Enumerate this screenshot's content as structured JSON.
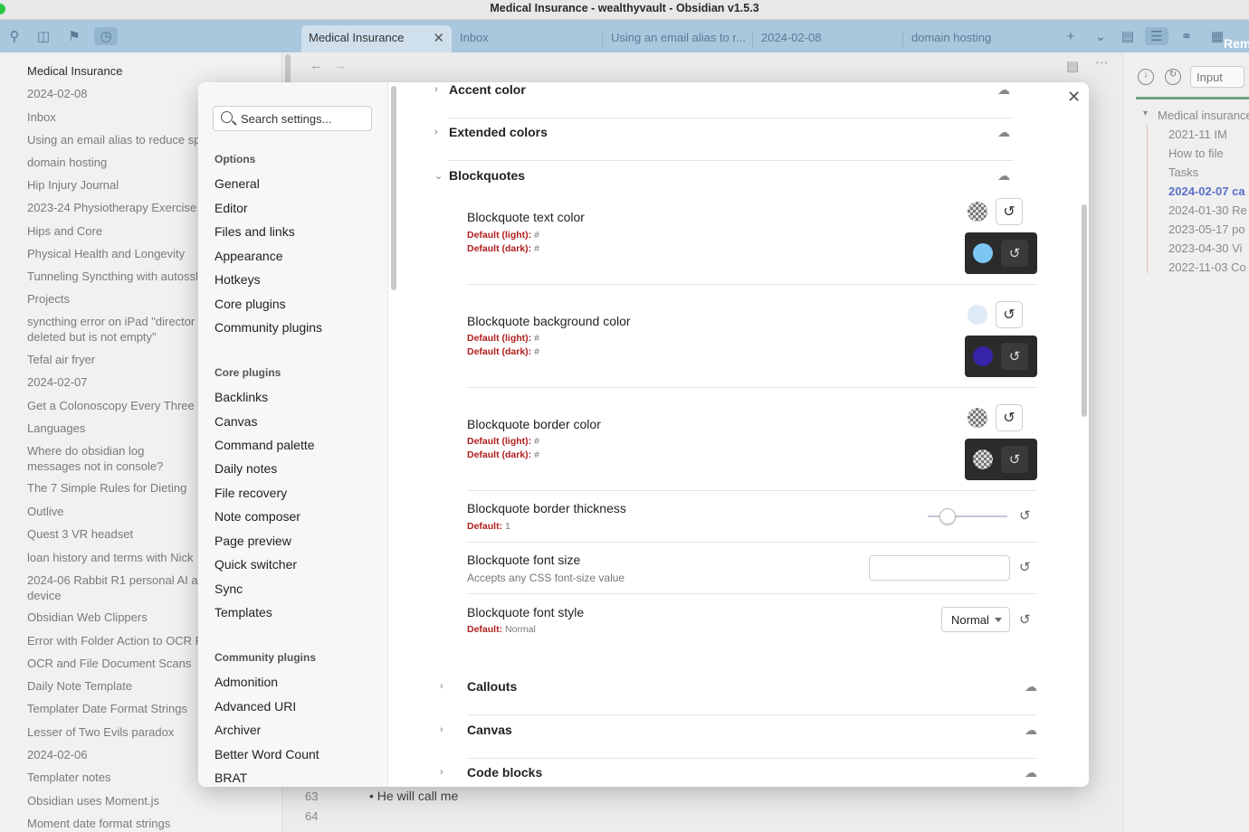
{
  "window": {
    "title": "Medical Insurance - wealthyvault - Obsidian v1.5.3"
  },
  "tabs": [
    {
      "label": "Medical Insurance",
      "active": true
    },
    {
      "label": "Inbox"
    },
    {
      "label": "Using an email alias to r..."
    },
    {
      "label": "2024-02-08"
    },
    {
      "label": "domain hosting"
    }
  ],
  "file_list": [
    "Medical Insurance",
    "2024-02-08",
    "Inbox",
    "Using an email alias to reduce sp",
    "domain hosting",
    "Hip Injury Journal",
    "2023-24 Physiotherapy Exercise",
    "Hips and Core",
    "Physical Health and Longevity",
    "Tunneling Syncthing with autossl",
    "Projects",
    "syncthing error on iPad \"director deleted but is not empty\"",
    "Tefal air fryer",
    "2024-02-07",
    "Get a Colonoscopy Every Three Y",
    "Languages",
    "Where do obsidian log messages not in console?",
    "The 7 Simple Rules for Dieting",
    "Outlive",
    "Quest 3 VR headset",
    "loan history and terms with Nick",
    "2024-06 Rabbit R1 personal AI a device",
    "Obsidian Web Clippers",
    "Error with Folder Action to OCR F",
    "OCR and File Document Scans",
    "Daily Note Template",
    "Templater Date Format Strings",
    "Lesser of Two Evils paradox",
    "2024-02-06",
    "Templater notes",
    "Obsidian uses Moment.js",
    "Moment date format strings"
  ],
  "editor": {
    "line_63": "63",
    "line_64": "64",
    "bullet_text": "He will call me"
  },
  "right_sidebar": {
    "input_placeholder": "Input",
    "tab_label": "Rem",
    "heading": "Medical insurance",
    "items": [
      "2021-11 IM",
      "How to file",
      "Tasks",
      "2024-02-07 ca",
      "2024-01-30 Re",
      "2023-05-17 po",
      "2023-04-30 Vi",
      "2022-11-03 Co"
    ]
  },
  "settings": {
    "search_placeholder": "Search settings...",
    "sections": [
      {
        "heading": "Options",
        "items": [
          "General",
          "Editor",
          "Files and links",
          "Appearance",
          "Hotkeys",
          "Core plugins",
          "Community plugins"
        ]
      },
      {
        "heading": "Core plugins",
        "items": [
          "Backlinks",
          "Canvas",
          "Command palette",
          "Daily notes",
          "File recovery",
          "Note composer",
          "Page preview",
          "Quick switcher",
          "Sync",
          "Templates"
        ]
      },
      {
        "heading": "Community plugins",
        "items": [
          "Admonition",
          "Advanced URI",
          "Archiver",
          "Better Word Count",
          "BRAT"
        ]
      }
    ]
  },
  "content": {
    "collapsed_top": [
      "Accent color",
      "Extended colors"
    ],
    "expanded": "Blockquotes",
    "collapsed_bottom": [
      "Callouts",
      "Canvas",
      "Code blocks"
    ],
    "default_light_label": "Default (light):",
    "default_dark_label": "Default (dark):",
    "hash": "#",
    "default_label": "Default:",
    "blockquote_text_color": "Blockquote text color",
    "blockquote_background_color": "Blockquote background color",
    "blockquote_border_color": "Blockquote border color",
    "blockquote_border_thickness": "Blockquote border thickness",
    "border_thickness_default": "1",
    "border_thickness_value": 0.15,
    "blockquote_font_size": "Blockquote font size",
    "font_size_desc": "Accepts any CSS font-size value",
    "blockquote_font_style": "Blockquote font style",
    "font_style_value": "Normal",
    "font_style_default": "Normal",
    "colors": {
      "text_dark": "#7cc6f5",
      "background_light": "#dfeaf7",
      "background_dark": "#3524a8"
    }
  }
}
